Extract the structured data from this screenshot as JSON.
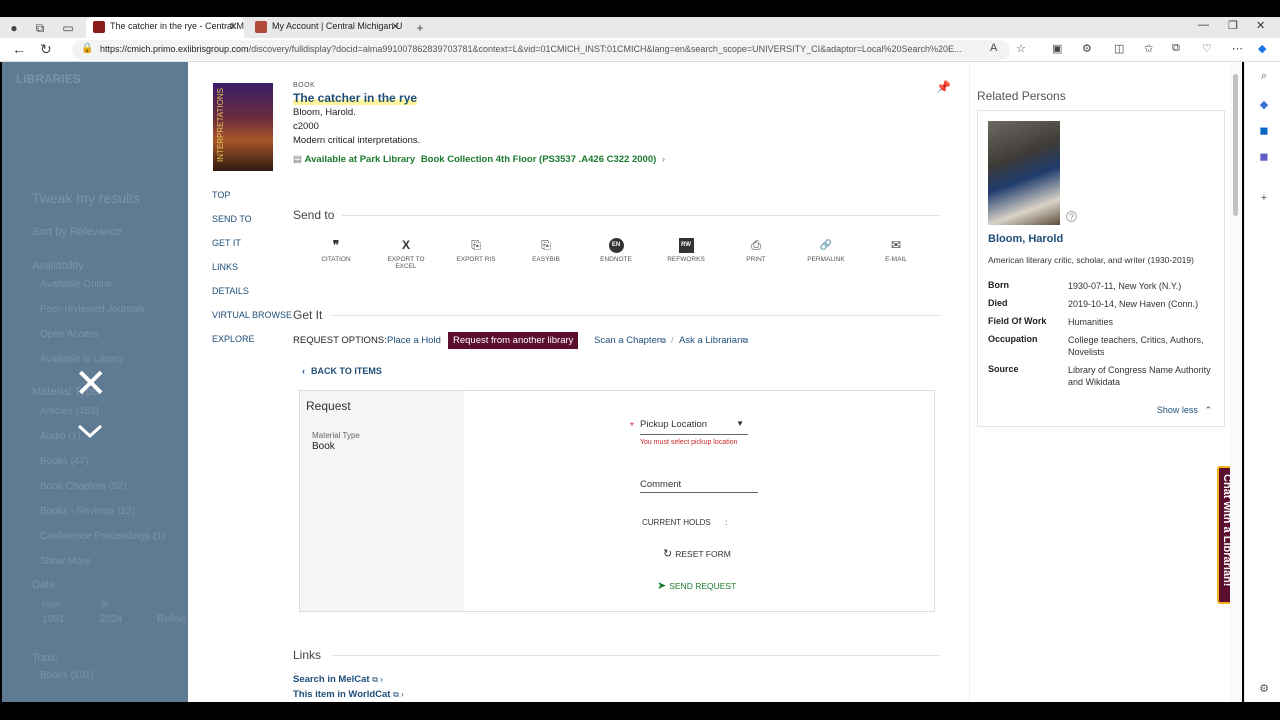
{
  "tabs": [
    {
      "title": "The catcher in the rye - Central M",
      "active": true,
      "favicon_color": "#8b1a1a"
    },
    {
      "title": "My Account | Central Michigan U",
      "active": false,
      "favicon_color": "#b04a3a"
    }
  ],
  "address": {
    "host": "https://cmich.primo.exlibrisgroup.com",
    "path": "/discovery/fulldisplay?docid=alma991007862839703781&context=L&vid=01CMICH_INST:01CMICH&lang=en&search_scope=UNIVERSITY_CI&adaptor=Local%20Search%20E..."
  },
  "left_panel": {
    "faint_items": [
      "Tweak my results",
      "Sort by Relevance",
      "Availability",
      "Available Online",
      "Peer-reviewed Journals",
      "Open Access",
      "Available in Library",
      "Material Type",
      "Articles (453)",
      "Audio (1)",
      "Books (47)",
      "Book Chapters (52)",
      "Books - Reviews (12)",
      "Conference Proceedings (1)",
      "Show More",
      "Date",
      "From",
      "1951",
      "To",
      "2024",
      "Refine",
      "Topic",
      "Books (191)"
    ]
  },
  "record": {
    "type": "BOOK",
    "title": "The catcher in the rye",
    "author": "Bloom, Harold.",
    "date": "c2000",
    "series": "Modern critical interpretations.",
    "availability": "Available at Park Library",
    "location": "Book Collection 4th Floor (PS3537 .A426 C322 2000)",
    "cover_text": "INTERPRETATIONS"
  },
  "side_nav": [
    "TOP",
    "SEND TO",
    "GET IT",
    "LINKS",
    "DETAILS",
    "VIRTUAL BROWSE",
    "EXPLORE"
  ],
  "send_to": {
    "heading": "Send to",
    "actions": [
      {
        "label": "CITATION",
        "glyph": "❞"
      },
      {
        "label": "EXPORT TO EXCEL",
        "glyph": "X"
      },
      {
        "label": "EXPORT RIS",
        "glyph": "⎘"
      },
      {
        "label": "EASYBIB",
        "glyph": "⎘"
      },
      {
        "label": "ENDNOTE",
        "glyph": "EN"
      },
      {
        "label": "REFWORKS",
        "glyph": "RW"
      },
      {
        "label": "PRINT",
        "glyph": "⎙"
      },
      {
        "label": "PERMALINK",
        "glyph": "🔗"
      },
      {
        "label": "E-MAIL",
        "glyph": "✉"
      }
    ]
  },
  "get_it": {
    "heading": "Get It",
    "options_label": "REQUEST OPTIONS:",
    "options": [
      "Place a Hold",
      "Request from another library",
      "Scan a Chapter",
      "Ask a Librarian"
    ],
    "back": "BACK TO ITEMS",
    "request_title": "Request",
    "material_type_label": "Material Type",
    "material_type_value": "Book",
    "pickup_label": "Pickup Location",
    "pickup_error": "You must select pickup location",
    "comment_label": "Comment",
    "current_holds": "CURRENT HOLDS",
    "current_holds_sep": ":",
    "reset": "RESET FORM",
    "send": "SEND REQUEST"
  },
  "links": {
    "heading": "Links",
    "items": [
      "Search in MelCat",
      "This item in WorldCat"
    ]
  },
  "related": {
    "heading": "Related Persons",
    "name": "Bloom, Harold",
    "desc": "American literary critic, scholar, and writer (1930-2019)",
    "rows": [
      {
        "k": "Born",
        "v": "1930-07-11, New York (N.Y.)"
      },
      {
        "k": "Died",
        "v": "2019-10-14, New Haven (Conn.)"
      },
      {
        "k": "Field Of Work",
        "v": "Humanities"
      },
      {
        "k": "Occupation",
        "v": "College teachers, Critics, Authors, Novelists"
      },
      {
        "k": "Source",
        "v": "Library of Congress Name Authority and Wikidata"
      }
    ],
    "show_less": "Show less"
  },
  "chat": "Chat with a Librarian!",
  "colors": {
    "accent": "#1e4e79",
    "maroon": "#5b0e2d",
    "green": "#1a7a2e",
    "error": "#c62828",
    "highlight": "#fff176"
  }
}
